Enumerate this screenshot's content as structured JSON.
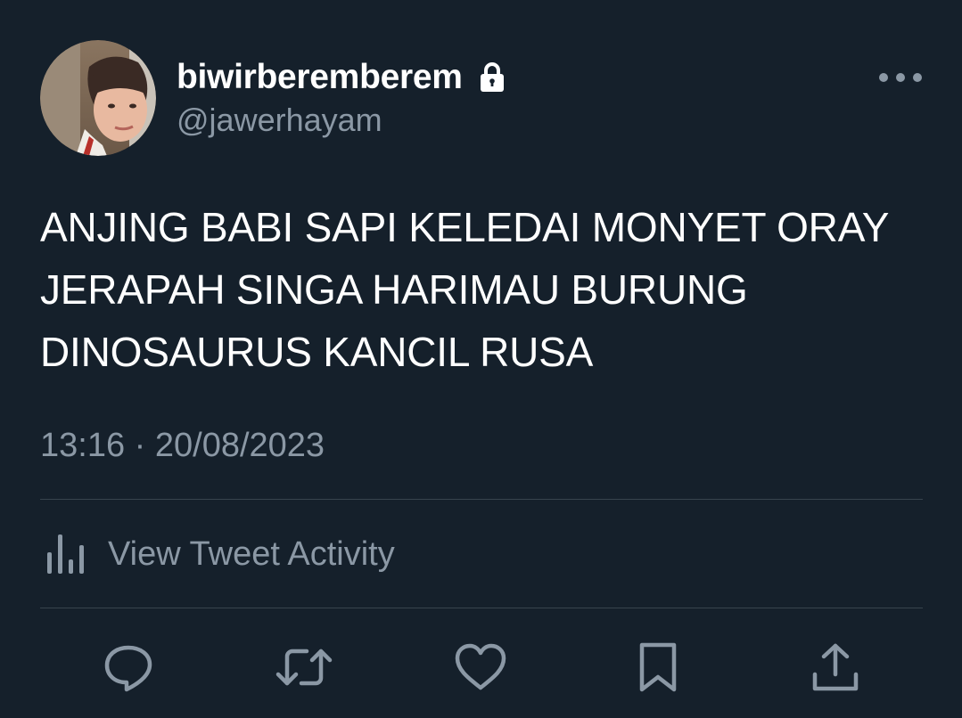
{
  "user": {
    "display_name": "biwirberemberem",
    "handle": "@jawerhayam",
    "protected_icon": "lock-icon",
    "avatar": "profile-photo"
  },
  "tweet": {
    "lines": [
      "ANJING BABI SAPI KELEDAI MONYET ORAY",
      "JERAPAH SINGA HARIMAU BURUNG",
      "DINOSAURUS KANCIL RUSA"
    ],
    "timestamp": "13:16 · 20/08/2023"
  },
  "activity": {
    "icon": "analytics-bars-icon",
    "label": "View Tweet Activity"
  },
  "actions": [
    {
      "name": "reply",
      "icon": "speech-bubble-icon"
    },
    {
      "name": "retweet",
      "icon": "retweet-arrows-icon"
    },
    {
      "name": "like",
      "icon": "heart-icon"
    },
    {
      "name": "bookmark",
      "icon": "bookmark-icon"
    },
    {
      "name": "share",
      "icon": "share-upload-icon"
    }
  ],
  "colors": {
    "background": "#15202b",
    "primary_text": "#ffffff",
    "secondary_text": "#8b98a5",
    "divider": "#38444d"
  }
}
